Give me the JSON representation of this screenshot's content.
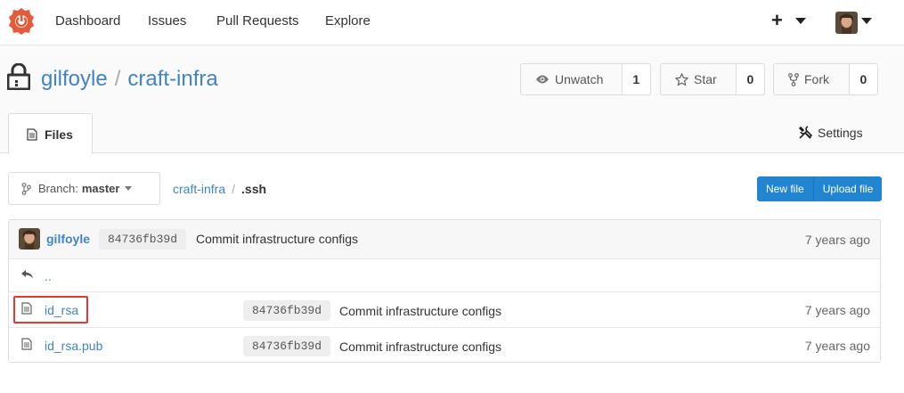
{
  "nav": {
    "items": [
      "Dashboard",
      "Issues",
      "Pull Requests",
      "Explore"
    ],
    "plus": "+"
  },
  "repo": {
    "owner": "gilfoyle",
    "separator": "/",
    "name": "craft-infra",
    "watch": {
      "label": "Unwatch",
      "count": "1"
    },
    "star": {
      "label": "Star",
      "count": "0"
    },
    "fork": {
      "label": "Fork",
      "count": "0"
    }
  },
  "tabs": {
    "files": "Files",
    "settings": "Settings"
  },
  "branch": {
    "prefix": "Branch:",
    "name": "master"
  },
  "breadcrumb": {
    "repo": "craft-infra",
    "sep": "/",
    "current": ".ssh"
  },
  "actions": {
    "new_file": "New file",
    "upload_file": "Upload file"
  },
  "latest_commit": {
    "author": "gilfoyle",
    "sha": "84736fb39d",
    "message": "Commit infrastructure configs",
    "age": "7 years ago"
  },
  "parent_link": "..",
  "files": [
    {
      "name": "id_rsa",
      "sha": "84736fb39d",
      "message": "Commit infrastructure configs",
      "age": "7 years ago"
    },
    {
      "name": "id_rsa.pub",
      "sha": "84736fb39d",
      "message": "Commit infrastructure configs",
      "age": "7 years ago"
    }
  ],
  "colors": {
    "link": "#4183c4",
    "primary": "#2185d0",
    "logo": "#e25b3b",
    "highlight": "#e53935"
  }
}
